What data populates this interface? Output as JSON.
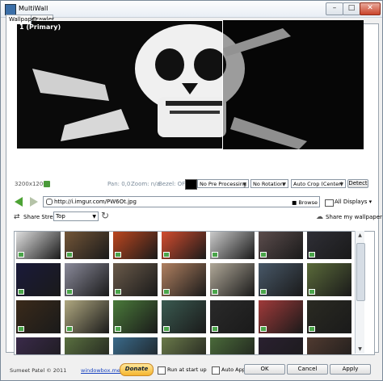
{
  "window": {
    "title": "MultiWall",
    "minimize": "–",
    "maximize": "□",
    "close": "✕"
  },
  "tabs": [
    {
      "label": "Wallpaper"
    },
    {
      "label": "Crawler"
    }
  ],
  "preview": {
    "monitor_label": "1 (Primary)",
    "resolution": "3200x1200"
  },
  "controls": {
    "pan": "Pan: 0,0",
    "zoom": "Zoom: n/a",
    "bezel": "Bezel: OFF",
    "processing": "No Pre Processing",
    "rotation": "No Rotation",
    "crop": "Auto Crop (Center)",
    "detect": "Detect"
  },
  "url": {
    "value": "http://i.imgur.com/PW6Ot.jpg",
    "browse": "Browse"
  },
  "displays": {
    "label": "All Displays"
  },
  "stream": {
    "label": "Share Stream",
    "selected": "Top"
  },
  "share": {
    "label": "Share my wallpaper"
  },
  "thumbnails": [
    [
      "#eeeeee",
      "#7a5a3a",
      "#c84a20",
      "#e05030",
      "#d8d8d8",
      "#605050",
      "#303038"
    ],
    [
      "#1a1a3a",
      "#8a8a9a",
      "#6a5a4a",
      "#b08060",
      "#b0a898",
      "#485868",
      "#5a6a3a"
    ],
    [
      "#3a2a1a",
      "#b0a880",
      "#4a7a3a",
      "#3a5a50",
      "#2a2a2a",
      "#a03a3a",
      "#2a2a22"
    ],
    [
      "#3a2a4a",
      "#5a7040",
      "#3a6a8a",
      "#6a7a4a",
      "#4a6a3a",
      "#2a2030",
      "#503a30"
    ]
  ],
  "footer": {
    "copyright": "Sumeet Patel © 2011",
    "link": "windowbox.me/multiwall",
    "donate": "Donate",
    "run_at_startup": "Run at start up",
    "auto_apply": "Auto Apply",
    "ok": "OK",
    "cancel": "Cancel",
    "apply": "Apply"
  }
}
